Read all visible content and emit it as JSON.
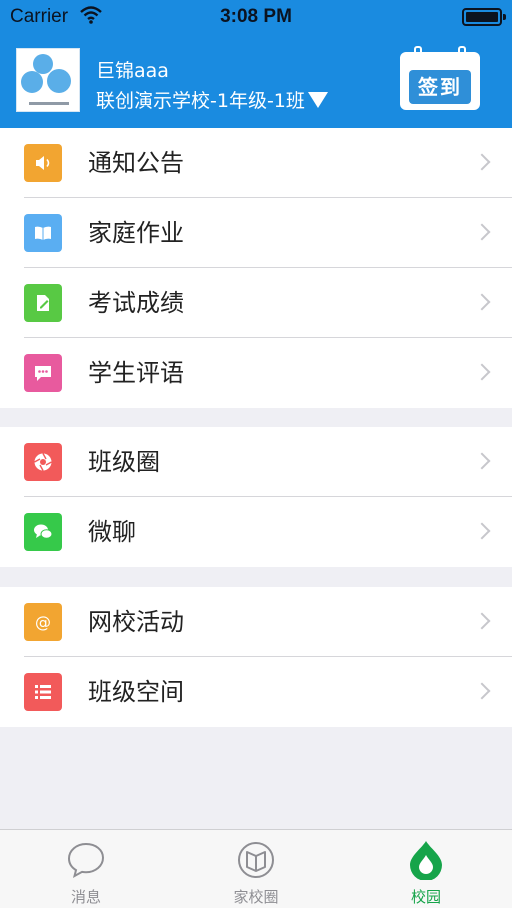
{
  "status_bar": {
    "carrier": "Carrier",
    "time": "3:08 PM"
  },
  "header": {
    "user_name": "巨锦aaa",
    "school_class": "联创演示学校-1年级-1班",
    "signin_label": "签到"
  },
  "menu_groups": [
    {
      "items": [
        {
          "label": "通知公告",
          "icon": "speaker-icon",
          "color": "#f2a531"
        },
        {
          "label": "家庭作业",
          "icon": "book-icon",
          "color": "#5aaef2"
        },
        {
          "label": "考试成绩",
          "icon": "pencil-icon",
          "color": "#58c944"
        },
        {
          "label": "学生评语",
          "icon": "comment-icon",
          "color": "#e85a9e"
        }
      ]
    },
    {
      "items": [
        {
          "label": "班级圈",
          "icon": "aperture-icon",
          "color": "#f25a5a"
        },
        {
          "label": "微聊",
          "icon": "chat-icon",
          "color": "#36c94a"
        }
      ]
    },
    {
      "items": [
        {
          "label": "网校活动",
          "icon": "at-icon",
          "color": "#f2a531"
        },
        {
          "label": "班级空间",
          "icon": "list-icon",
          "color": "#f25a5a"
        }
      ]
    }
  ],
  "tabs": [
    {
      "label": "消息",
      "icon": "speech-bubble-icon",
      "active": false
    },
    {
      "label": "家校圈",
      "icon": "compass-icon",
      "active": false
    },
    {
      "label": "校园",
      "icon": "drop-icon",
      "active": true
    }
  ],
  "colors": {
    "header_bg": "#1a8be0",
    "active_tab": "#16a44a",
    "inactive_tab": "#8e8e93"
  }
}
